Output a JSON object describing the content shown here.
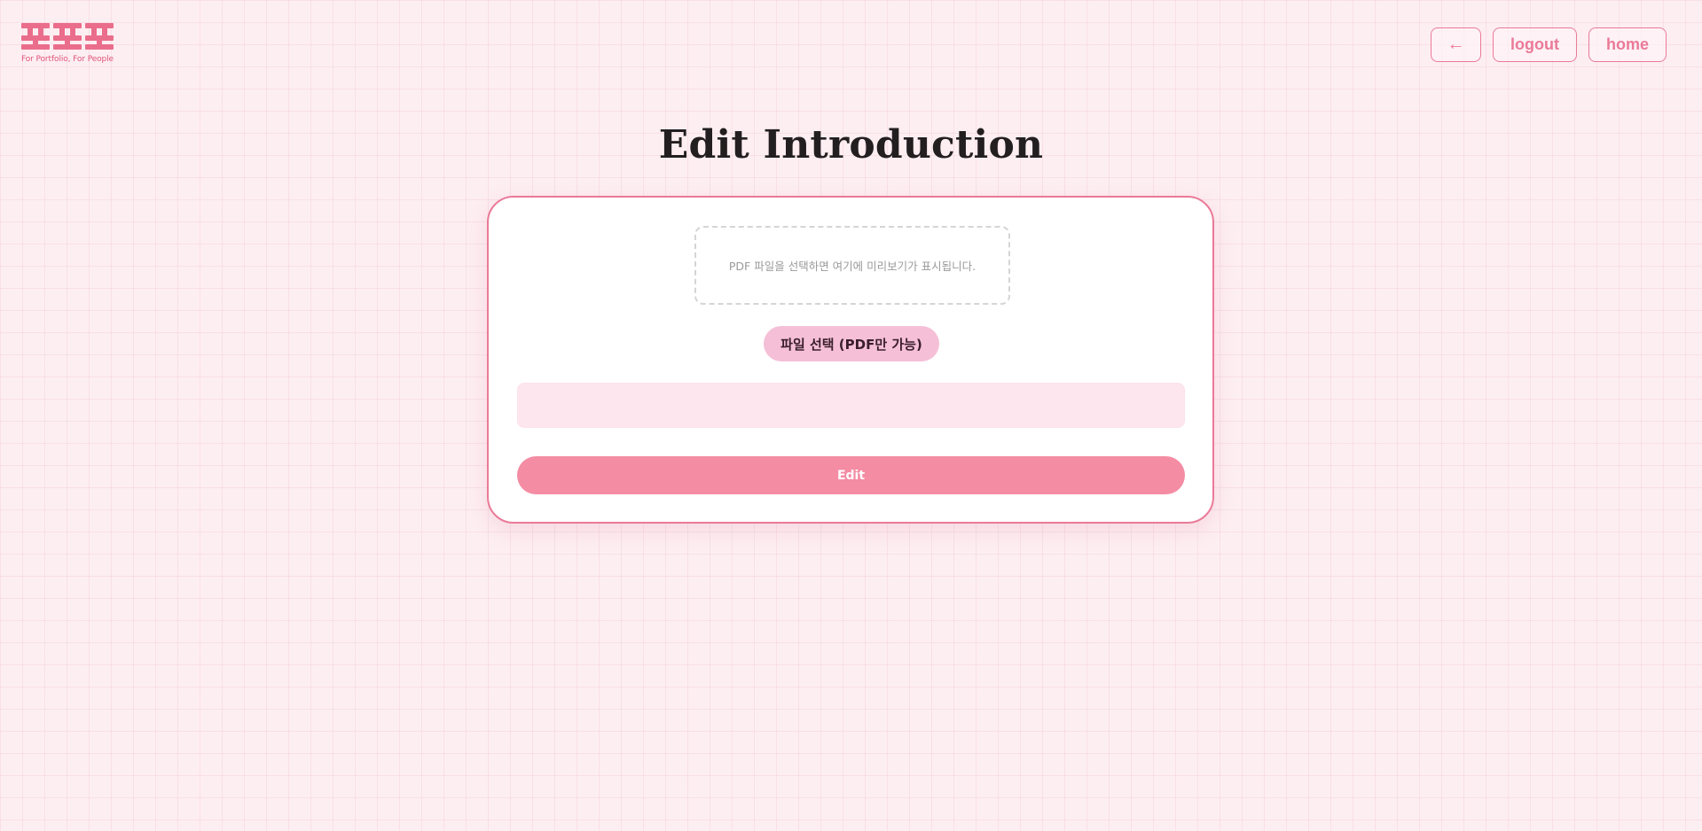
{
  "brand": {
    "tagline": "For Portfolio, For People",
    "logo_icon": "po-po-po-logo"
  },
  "nav": {
    "back_label": "←",
    "logout_label": "logout",
    "home_label": "home"
  },
  "page": {
    "title": "Edit Introduction"
  },
  "form": {
    "preview_placeholder": "PDF 파일을 선택하면 여기에 미리보기가 표시됩니다.",
    "file_button_label": "파일 선택 (PDF만 가능)",
    "description_value": "",
    "submit_label": "Edit"
  },
  "colors": {
    "background": "#fdeef2",
    "accent": "#ea7a98",
    "logo": "#ea6d8c",
    "file_button": "#f5c0d7",
    "input_fill": "#fde6ee",
    "submit_button": "#f48ca4"
  }
}
